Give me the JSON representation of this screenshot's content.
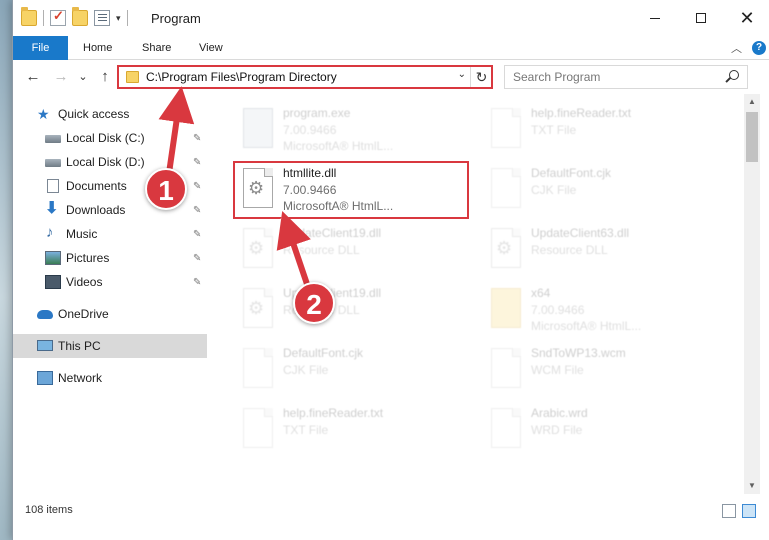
{
  "window": {
    "title": "Program",
    "controls": {
      "minimize": "minimize",
      "maximize": "maximize",
      "close": "✕"
    }
  },
  "ribbon": {
    "tabs": [
      "File",
      "Home",
      "Share",
      "View"
    ],
    "collapse_icon": "chevron-up-icon",
    "help_label": "?"
  },
  "nav": {
    "back": "←",
    "forward": "→",
    "recent": "⌄",
    "up": "↑",
    "address": "C:\\Program Files\\Program Directory",
    "dropdown": "⌄",
    "refresh": "↻",
    "search_placeholder": "Search Program"
  },
  "sidebar": {
    "items": [
      {
        "label": "Quick access",
        "icon": "star-icon",
        "pinned": false
      },
      {
        "label": "Local Disk (C:)",
        "icon": "disk-icon",
        "pinned": true
      },
      {
        "label": "Local Disk (D:)",
        "icon": "disk-icon",
        "pinned": true
      },
      {
        "label": "Documents",
        "icon": "documents-icon",
        "pinned": true
      },
      {
        "label": "Downloads",
        "icon": "downloads-icon",
        "pinned": true
      },
      {
        "label": "Music",
        "icon": "music-icon",
        "pinned": true
      },
      {
        "label": "Pictures",
        "icon": "pictures-icon",
        "pinned": true
      },
      {
        "label": "Videos",
        "icon": "videos-icon",
        "pinned": true
      },
      {
        "label": "OneDrive",
        "icon": "onedrive-icon",
        "pinned": false
      },
      {
        "label": "This PC",
        "icon": "computer-icon",
        "pinned": false,
        "selected": true
      },
      {
        "label": "Network",
        "icon": "network-icon",
        "pinned": false
      }
    ],
    "pin_glyph": "📌"
  },
  "files": [
    {
      "name": "program.exe",
      "line2": "7.00.9466",
      "line3": "MicrosoftA® HtmlL...",
      "faded": true
    },
    {
      "name": "help.fineReader.txt",
      "line2": "TXT File",
      "line3": "",
      "faded": true
    },
    {
      "name": "htmllite.dll",
      "line2": "7.00.9466",
      "line3": "MicrosoftA® HtmlL...",
      "faded": false
    },
    {
      "name": "DefaultFont.cjk",
      "line2": "CJK File",
      "line3": "",
      "faded": true
    },
    {
      "name": "UpdateClient19.dll",
      "line2": "Resource DLL",
      "line3": "",
      "faded": true
    },
    {
      "name": "UpdateClient63.dll",
      "line2": "Resource DLL",
      "line3": "",
      "faded": true
    },
    {
      "name": "UpdateClient19.dll",
      "line2": "Resource DLL",
      "line3": "",
      "faded": true
    },
    {
      "name": "x64",
      "line2": "7.00.9466",
      "line3": "MicrosoftA® HtmlL...",
      "faded": true
    },
    {
      "name": "DefaultFont.cjk",
      "line2": "CJK File",
      "line3": "",
      "faded": true
    },
    {
      "name": "SndToWP13.wcm",
      "line2": "WCM File",
      "line3": "",
      "faded": true
    },
    {
      "name": "help.fineReader.txt",
      "line2": "TXT File",
      "line3": "",
      "faded": true
    },
    {
      "name": "Arabic.wrd",
      "line2": "WRD File",
      "line3": "",
      "faded": true
    }
  ],
  "status": {
    "item_count": "108 items"
  },
  "callouts": {
    "step1": "1",
    "step2": "2"
  },
  "colors": {
    "accent": "#1979ca",
    "highlight": "#d9383f",
    "selected_bg": "#d9d9d9"
  }
}
